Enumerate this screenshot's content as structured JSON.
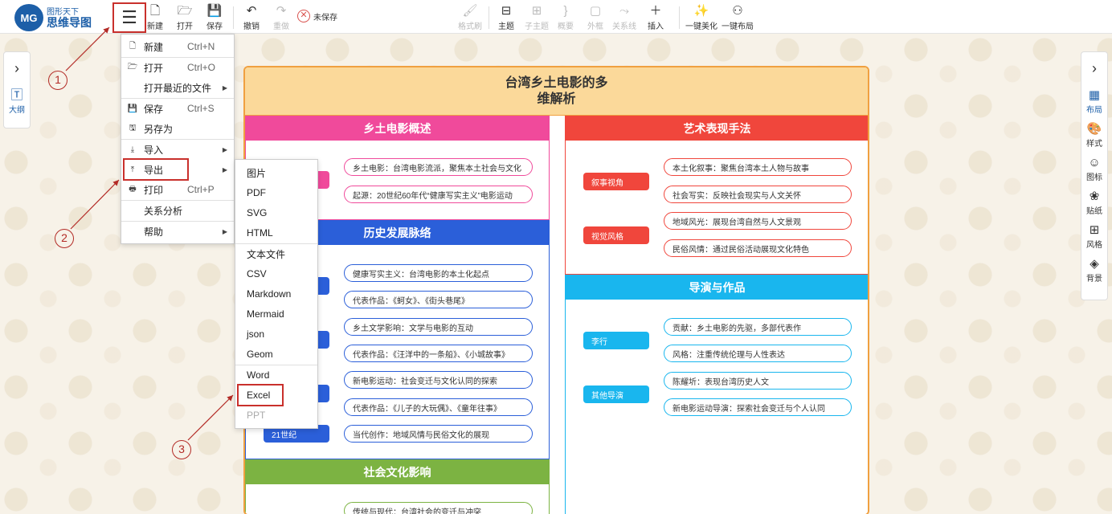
{
  "logo": {
    "mark": "MG",
    "top": "图形天下",
    "main": "思维导图"
  },
  "toolbar": {
    "new": "新建",
    "open": "打开",
    "save": "保存",
    "undo": "撤销",
    "redo": "重做",
    "unsaved": "未保存",
    "format_brush": "格式刷",
    "topic": "主题",
    "subtopic": "子主题",
    "summary": "概要",
    "frame": "外框",
    "relation": "关系线",
    "insert": "插入",
    "beautify": "一键美化",
    "layout": "一键布局"
  },
  "left_panel": {
    "outline": "大纲"
  },
  "right_panel": {
    "items": [
      "布局",
      "样式",
      "图标",
      "贴纸",
      "风格",
      "背景"
    ]
  },
  "map": {
    "title_line1": "台湾乡土电影的多",
    "title_line2": "维解析",
    "sections": {
      "overview": {
        "title": "乡土电影概述",
        "leaves": [
          "乡土电影：台湾电影流派，聚焦本土社会与文化",
          "起源：20世纪60年代“健康写实主义”电影运动"
        ]
      },
      "history": {
        "title": "历史发展脉络",
        "leaves": [
          "健康写实主义：台湾电影的本土化起点",
          "代表作品：《蚵女》、《街头巷尾》",
          "乡土文学影响：文学与电影的互动",
          "代表作品：《汪洋中的一条船》、《小城故事》",
          "新电影运动：社会变迁与文化认同的探索",
          "代表作品：《儿子的大玩偶》、《童年往事》",
          "当代创作：地域风情与民俗文化的展现"
        ],
        "mid_last": "21世纪"
      },
      "social": {
        "title": "社会文化影响",
        "leaves": [
          "传统与现代：台湾社会的变迁与冲突"
        ]
      },
      "art": {
        "title": "艺术表现手法",
        "mids": [
          "叙事视角",
          "视觉风格"
        ],
        "leaves": [
          "本土化叙事：聚焦台湾本土人物与故事",
          "社会写实：反映社会现实与人文关怀",
          "地域风光：展现台湾自然与人文景观",
          "民俗风情：通过民俗活动展现文化特色"
        ]
      },
      "director": {
        "title": "导演与作品",
        "mids": [
          "李行",
          "其他导演"
        ],
        "leaves": [
          "贡献：乡土电影的先驱，多部代表作",
          "风格：注重传统伦理与人性表达",
          "陈耀圻：表现台湾历史人文",
          "新电影运动导演：探索社会变迁与个人认同"
        ]
      }
    }
  },
  "menu": {
    "new": "新建",
    "new_sc": "Ctrl+N",
    "open": "打开",
    "open_sc": "Ctrl+O",
    "recent": "打开最近的文件",
    "save": "保存",
    "save_sc": "Ctrl+S",
    "save_as": "另存为",
    "import": "导入",
    "export": "导出",
    "print": "打印",
    "print_sc": "Ctrl+P",
    "relation": "关系分析",
    "help": "帮助"
  },
  "submenu": [
    "图片",
    "PDF",
    "SVG",
    "HTML",
    "文本文件",
    "CSV",
    "Markdown",
    "Mermaid",
    "json",
    "Geom",
    "Word",
    "Excel",
    "PPT"
  ],
  "annotations": [
    "1",
    "2",
    "3"
  ],
  "colors": {
    "accent": "#1d5fa8",
    "annotation": "#b32b26",
    "overview": "#f04a9b",
    "history": "#2b5fd9",
    "social": "#7cb342",
    "art": "#f0463c",
    "director": "#19b6ee"
  }
}
